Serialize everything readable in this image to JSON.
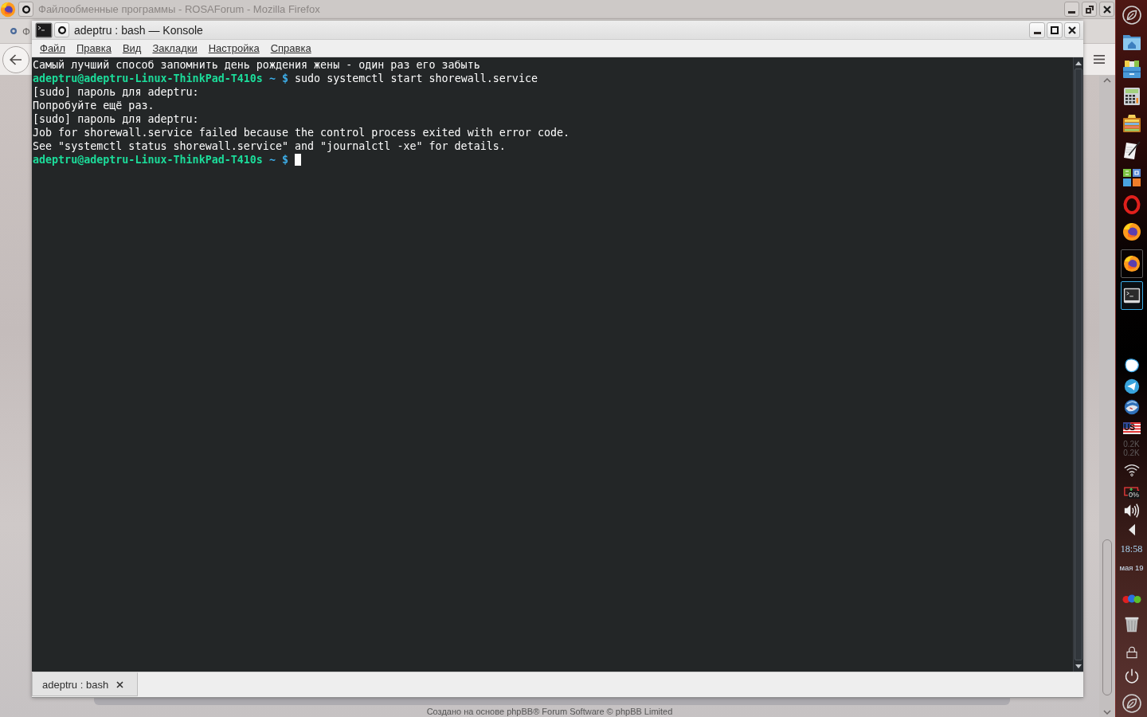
{
  "browser_window": {
    "title": "Файлообменные программы - ROSAForum - Mozilla Firefox",
    "tab_title": "Ф",
    "footer": "Создано на основе phpBB® Forum Software © phpBB Limited"
  },
  "konsole": {
    "title": "adeptru : bash — Konsole",
    "menu": [
      "Файл",
      "Правка",
      "Вид",
      "Закладки",
      "Настройка",
      "Справка"
    ],
    "lines": [
      {
        "kind": "output",
        "text": "Самый лучший способ запомнить день рождения жены - один раз его забыть"
      },
      {
        "kind": "prompt",
        "user": "adeptru@adeptru-Linux-ThinkPad-T410s",
        "path": "~",
        "symbol": "$",
        "command": "sudo systemctl start shorewall.service"
      },
      {
        "kind": "output",
        "text": "[sudo] пароль для adeptru:"
      },
      {
        "kind": "output",
        "text": "Попробуйте ещё раз."
      },
      {
        "kind": "output",
        "text": "[sudo] пароль для adeptru:"
      },
      {
        "kind": "output",
        "text": "Job for shorewall.service failed because the control process exited with error code."
      },
      {
        "kind": "output",
        "text": "See \"systemctl status shorewall.service\" and \"journalctl -xe\" for details."
      },
      {
        "kind": "prompt",
        "user": "adeptru@adeptru-Linux-ThinkPad-T410s",
        "path": "~",
        "symbol": "$",
        "cursor": true
      }
    ],
    "tabs": [
      {
        "label": "adeptru : bash",
        "selected": true
      }
    ]
  },
  "dock": {
    "tasks": [
      {
        "kind": "browser",
        "selected": false
      },
      {
        "kind": "terminal",
        "selected": true
      }
    ],
    "keyboard_layout": "US",
    "net_speed": [
      "0.2K",
      "0.2K"
    ],
    "battery": "0%",
    "time": "18:58",
    "date": "мая 19"
  }
}
